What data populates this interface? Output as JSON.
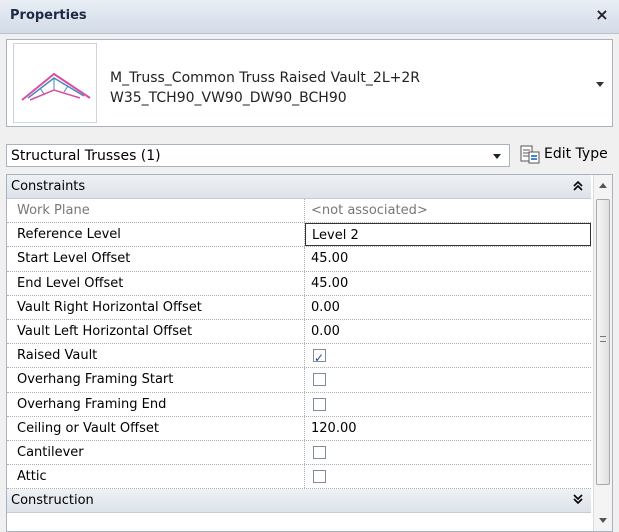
{
  "window": {
    "title": "Properties",
    "close_label": "×"
  },
  "type_selector": {
    "line1": "M_Truss_Common Truss Raised Vault_2L+2R",
    "line2": "W35_TCH90_VW90_DW90_BCH90"
  },
  "filter": {
    "selected": "Structural Trusses (1)",
    "edit_type_label": "Edit Type"
  },
  "sections": {
    "constraints": {
      "title": "Constraints",
      "collapse_glyph": "»",
      "rows": [
        {
          "name": "Work Plane",
          "value": "<not associated>",
          "kind": "text",
          "dim": true
        },
        {
          "name": "Reference Level",
          "value": "Level 2",
          "kind": "text",
          "editing": true
        },
        {
          "name": "Start Level Offset",
          "value": "45.00",
          "kind": "text"
        },
        {
          "name": "End Level Offset",
          "value": "45.00",
          "kind": "text"
        },
        {
          "name": "Vault Right Horizontal Offset",
          "value": "0.00",
          "kind": "text"
        },
        {
          "name": "Vault Left Horizontal Offset",
          "value": "0.00",
          "kind": "text"
        },
        {
          "name": "Raised Vault",
          "checked": true,
          "kind": "checkbox"
        },
        {
          "name": "Overhang Framing Start",
          "checked": false,
          "kind": "checkbox"
        },
        {
          "name": "Overhang Framing End",
          "checked": false,
          "kind": "checkbox"
        },
        {
          "name": "Ceiling or Vault Offset",
          "value": "120.00",
          "kind": "text"
        },
        {
          "name": "Cantilever",
          "checked": false,
          "kind": "checkbox"
        },
        {
          "name": "Attic",
          "checked": false,
          "kind": "checkbox"
        }
      ]
    },
    "construction": {
      "title": "Construction",
      "collapse_glyph": "»"
    }
  },
  "colors": {
    "accent": "#1b4e9b",
    "truss_pink": "#d94fa0",
    "truss_blue": "#4a86c5"
  },
  "icons": {
    "close": "close-icon",
    "dropdown": "chevron-down-icon",
    "edit_type": "edit-type-icon",
    "collapse": "collapse-icon",
    "scroll_up": "scroll-up-icon",
    "scroll_down": "scroll-down-icon"
  }
}
